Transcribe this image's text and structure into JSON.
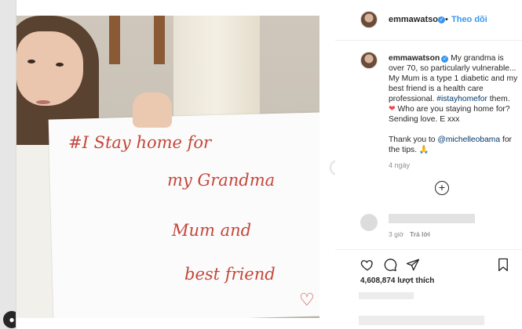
{
  "post": {
    "header": {
      "username": "emmawatson",
      "separator": "•",
      "follow_label": "Theo dõi"
    },
    "photo": {
      "alt_label": "Photo of a woman holding a handwritten sign",
      "sign_lines": [
        "#I  Stay home for",
        "my Grandma",
        "Mum and",
        "best  friend"
      ],
      "sign_heart": "♡"
    },
    "caption": {
      "username": "emmawatson",
      "text_1": " My grandma is over 70, so particularly vulnerable... My Mum is a type 1 diabetic and my best friend is a health care professional. ",
      "hashtag": "#istayhomefor",
      "text_2": " them.",
      "heart": "❤",
      "text_3": " Who are you staying home for? Sending love. E xxx",
      "text_4": "Thank you to ",
      "mention": "@michelleobama",
      "text_5": " for the tips. 🙏",
      "time": "4 ngày"
    },
    "comment": {
      "time": "3 giờ",
      "reply_label": "Trả lời"
    },
    "actions": {
      "likes": "4,608,874 lượt thích"
    },
    "colors": {
      "link": "#00376b",
      "accent": "#3897f0",
      "sign_ink": "#c5463a"
    }
  }
}
